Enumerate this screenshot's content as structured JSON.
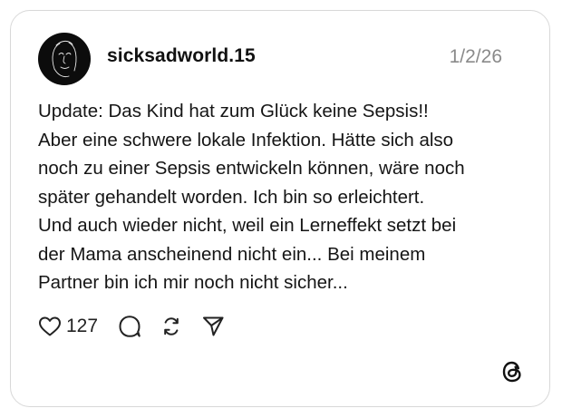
{
  "post": {
    "username": "sicksadworld.15",
    "date": "1/2/26",
    "text_lines": [
      "Update: Das Kind hat zum Glück keine Sepsis!!",
      "Aber eine schwere lokale Infektion. Hätte sich also",
      "noch zu einer Sepsis entwickeln können, wäre noch",
      "später gehandelt worden. Ich bin so erleichtert.",
      "Und auch wieder nicht, weil ein Lerneffekt setzt bei",
      "der Mama anscheinend nicht ein... Bei meinem",
      "Partner bin ich mir noch nicht sicher..."
    ]
  },
  "actions": {
    "like_count": "127",
    "like_icon": "heart-icon",
    "comment_icon": "comment-bubble-icon",
    "repost_icon": "repost-icon",
    "share_icon": "send-icon"
  },
  "branding": {
    "logo_icon": "threads-logo-icon"
  },
  "colors": {
    "text": "#151515",
    "muted": "#8a8a8a",
    "border": "#d8d8d8",
    "avatar_bg": "#0c0c0c"
  }
}
